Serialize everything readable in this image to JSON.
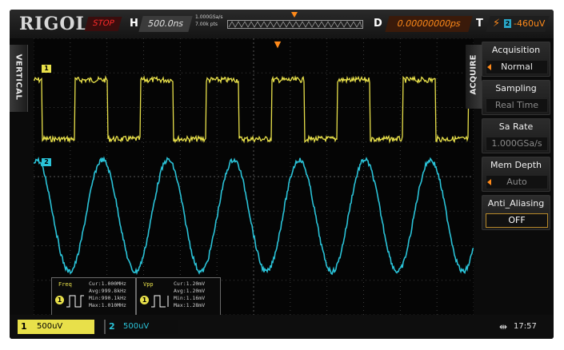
{
  "brand": "RIGOL",
  "run_state": "STOP",
  "horizontal": {
    "label": "H",
    "timebase": "500.0ns",
    "sample_rate": "1.000GSa/s",
    "memory": "7.00k pts"
  },
  "delay": {
    "label": "D",
    "value": "0.00000000ps"
  },
  "trigger": {
    "label": "T",
    "edge_icon": "rising-edge-icon",
    "source": "2",
    "level": "-460uV"
  },
  "tabs": {
    "vertical": "VERTICAL",
    "acquire": "ACQUIRE"
  },
  "menu": {
    "acquisition": {
      "title": "Acquisition",
      "value": "Normal"
    },
    "sampling": {
      "title": "Sampling",
      "value": "Real Time"
    },
    "sa_rate": {
      "title": "Sa Rate",
      "value": "1.000GSa/s"
    },
    "mem_depth": {
      "title": "Mem Depth",
      "value": "Auto"
    },
    "anti_aliasing": {
      "title": "Anti_Aliasing",
      "value": "OFF"
    }
  },
  "channels": [
    {
      "num": "1",
      "marker": "1",
      "scale": "500uV",
      "color": "#e8e04a"
    },
    {
      "num": "2",
      "marker": "2",
      "scale": "500uV",
      "color": "#2ac3d8"
    }
  ],
  "measurements": {
    "freq": {
      "name": "Freq",
      "source": "1",
      "cur": "Cur:1.000MHz",
      "avg": "Avg:999.8kHz",
      "min": "Min:990.1kHz",
      "max": "Max:1.010MHz"
    },
    "vpp": {
      "name": "Vpp",
      "source": "1",
      "cur": "Cur:1.20mV",
      "avg": "Avg:1.20mV",
      "min": "Min:1.16mV",
      "max": "Max:1.28mV"
    }
  },
  "status": {
    "time": "17:57",
    "usb_icon": "usb-icon"
  },
  "colors": {
    "ch1": "#e8e04a",
    "ch2": "#2ac3d8",
    "trigger": "#ff8a1a",
    "stop": "#ff2a2a"
  }
}
